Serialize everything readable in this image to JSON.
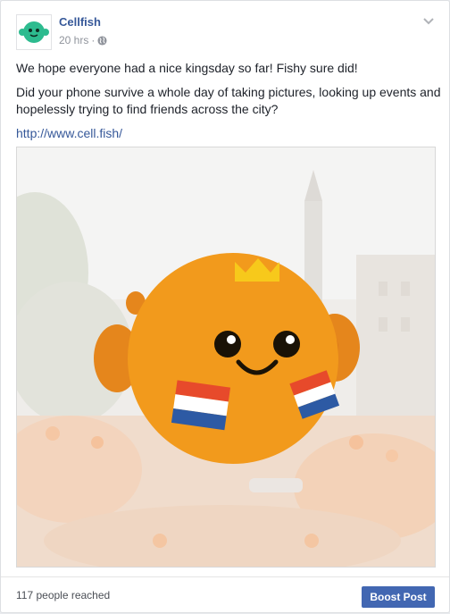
{
  "post": {
    "page_name": "Cellfish",
    "time": "20 hrs",
    "separator": "·",
    "audience_icon": "globe-icon",
    "menu_icon": "chevron-down-icon",
    "paragraphs": [
      "We hope everyone had a nice kingsday so far! Fishy sure did!",
      "Did your phone survive a whole day of taking pictures, looking up events and hopelessly trying to find friends across the city?"
    ],
    "link": "http://www.cell.fish/"
  },
  "footer": {
    "reach": "117 people reached",
    "boost_label": "Boost Post"
  },
  "colors": {
    "brand_link": "#365899",
    "boost_button": "#4267b2",
    "mascot_orange": "#f29a1c",
    "avatar_teal": "#2dbb8f"
  }
}
